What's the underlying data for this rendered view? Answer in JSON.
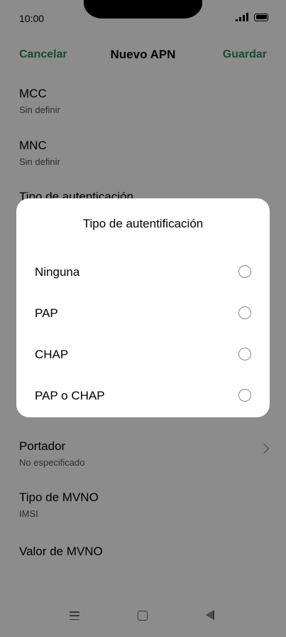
{
  "status": {
    "time": "10:00"
  },
  "header": {
    "cancel": "Cancelar",
    "title": "Nuevo APN",
    "save": "Guardar"
  },
  "settings": [
    {
      "label": "MCC",
      "value": "Sin definir"
    },
    {
      "label": "MNC",
      "value": "Sin definir"
    },
    {
      "label": "Tipo de autenticación",
      "value": ""
    },
    {
      "label": "Portador",
      "value": "No especificado"
    },
    {
      "label": "Tipo de MVNO",
      "value": "IMSI"
    },
    {
      "label": "Valor de MVNO",
      "value": ""
    }
  ],
  "dialog": {
    "title": "Tipo de autentificación",
    "options": [
      {
        "label": "Ninguna",
        "selected": false
      },
      {
        "label": "PAP",
        "selected": false
      },
      {
        "label": "CHAP",
        "selected": false
      },
      {
        "label": "PAP o CHAP",
        "selected": false
      }
    ]
  },
  "colors": {
    "accent": "#2d8a4e",
    "overlay": "#00000073"
  },
  "icons": {
    "chevron": "chevron-right-icon",
    "nav": [
      "menu-icon",
      "home-icon",
      "back-icon"
    ]
  }
}
